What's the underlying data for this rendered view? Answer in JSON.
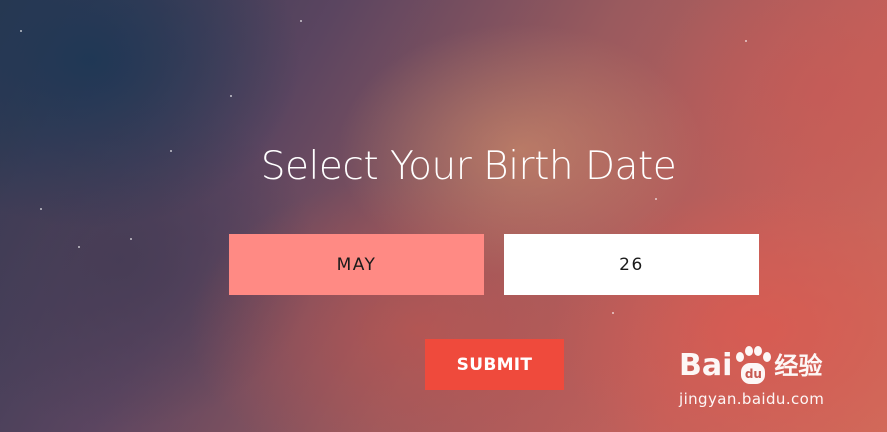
{
  "page": {
    "title": "Select Your Birth Date"
  },
  "form": {
    "month_value": "MAY",
    "day_value": "26",
    "submit_label": "SUBMIT"
  },
  "watermark": {
    "brand_left": "Bai",
    "brand_paw": "du",
    "brand_cn": "经验",
    "url": "jingyan.baidu.com"
  },
  "colors": {
    "month_field_bg": "#ff8a84",
    "day_field_bg": "#ffffff",
    "submit_bg": "#ef4a3c",
    "title_text": "#ffffff"
  }
}
